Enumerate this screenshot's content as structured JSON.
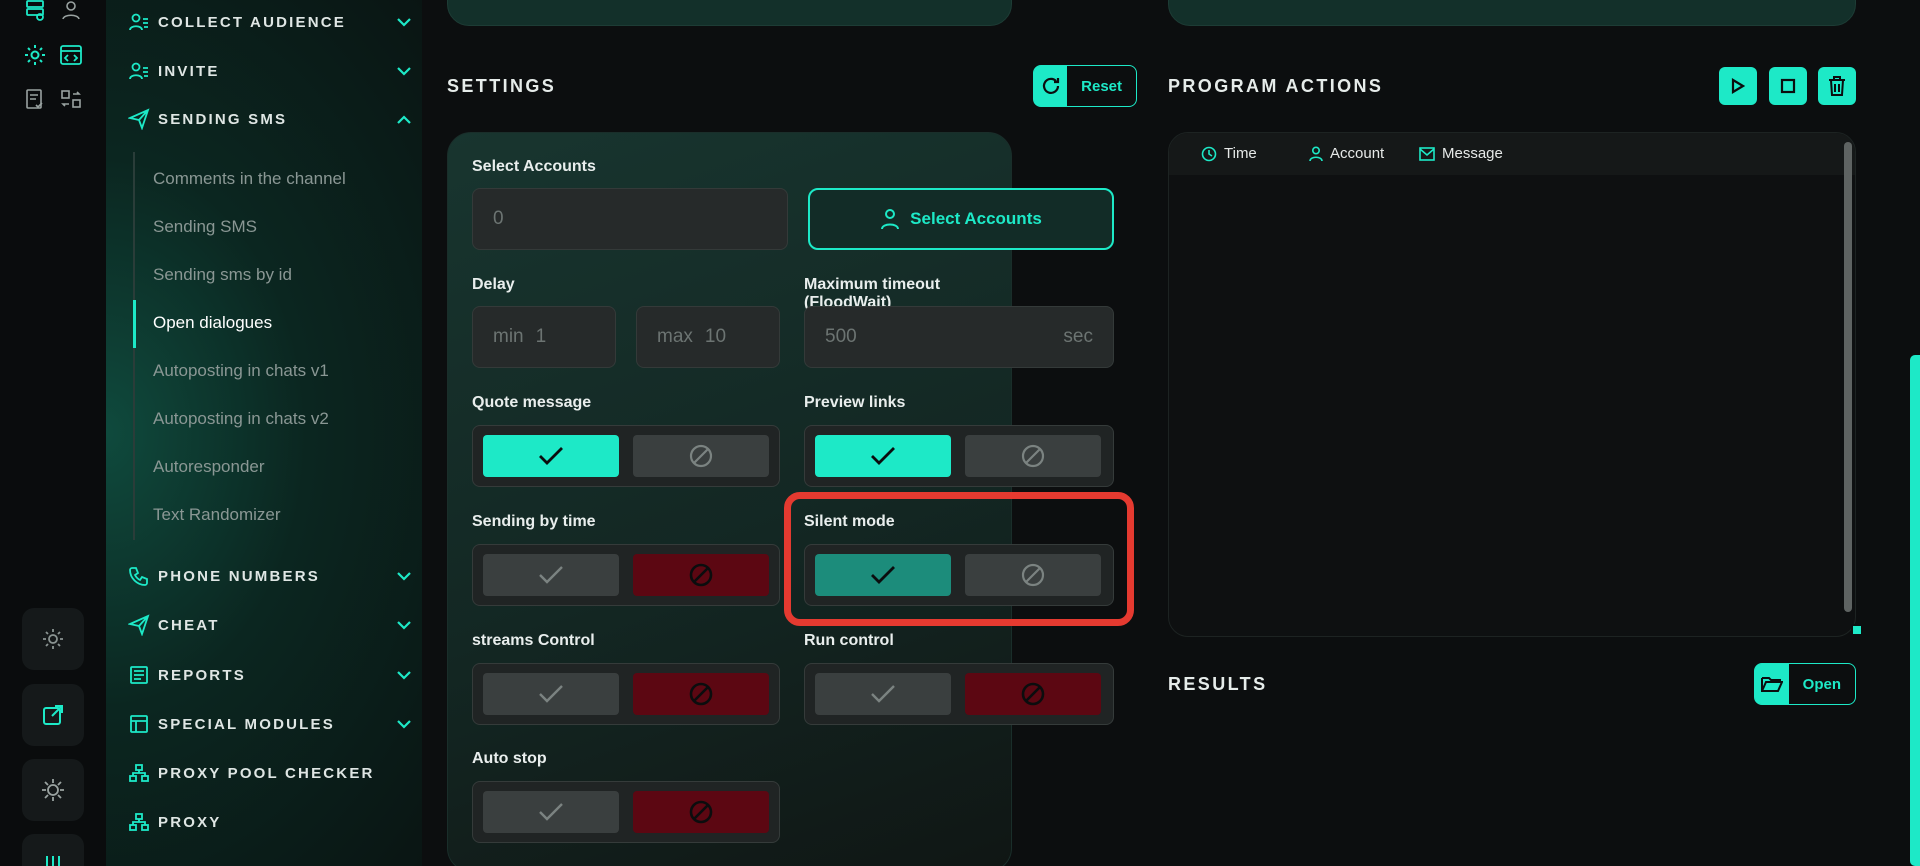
{
  "sidebar": {
    "sections": {
      "collect_audience": "COLLECT AUDIENCE",
      "invite": "INVITE",
      "sending_sms": "SENDING SMS",
      "phone_numbers": "PHONE NUMBERS",
      "cheat": "CHEAT",
      "reports": "REPORTS",
      "special_modules": "SPECIAL MODULES",
      "proxy_pool_checker": "PROXY POOL CHECKER",
      "proxy": "PROXY"
    },
    "sub_items": [
      "Comments in the channel",
      "Sending SMS",
      "Sending sms by id",
      "Open dialogues",
      "Autoposting in chats v1",
      "Autoposting in chats v2",
      "Autoresponder",
      "Text Randomizer"
    ],
    "active_sub_item": "Open dialogues"
  },
  "settings": {
    "title": "SETTINGS",
    "reset_label": "Reset",
    "select_accounts_label": "Select Accounts",
    "accounts_count": "0",
    "select_accounts_button": "Select Accounts",
    "delay_label": "Delay",
    "delay_min_prefix": "min",
    "delay_min_value": "1",
    "delay_max_prefix": "max",
    "delay_max_value": "10",
    "max_timeout_label": "Maximum timeout (FloodWait)",
    "max_timeout_value": "500",
    "max_timeout_unit": "sec",
    "quote_message_label": "Quote message",
    "quote_message_state": "on",
    "preview_links_label": "Preview links",
    "preview_links_state": "on",
    "sending_by_time_label": "Sending by time",
    "sending_by_time_state": "off",
    "silent_mode_label": "Silent mode",
    "silent_mode_state": "on",
    "streams_control_label": "streams Control",
    "streams_control_state": "off",
    "run_control_label": "Run control",
    "run_control_state": "off",
    "auto_stop_label": "Auto stop",
    "auto_stop_state": "off"
  },
  "program_actions": {
    "title": "PROGRAM ACTIONS",
    "columns": [
      "Time",
      "Account",
      "Message"
    ]
  },
  "results": {
    "title": "RESULTS",
    "open_label": "Open"
  },
  "colors": {
    "accent": "#1de9c7",
    "off_red": "#5c0712",
    "highlight_red": "#e53a30"
  }
}
